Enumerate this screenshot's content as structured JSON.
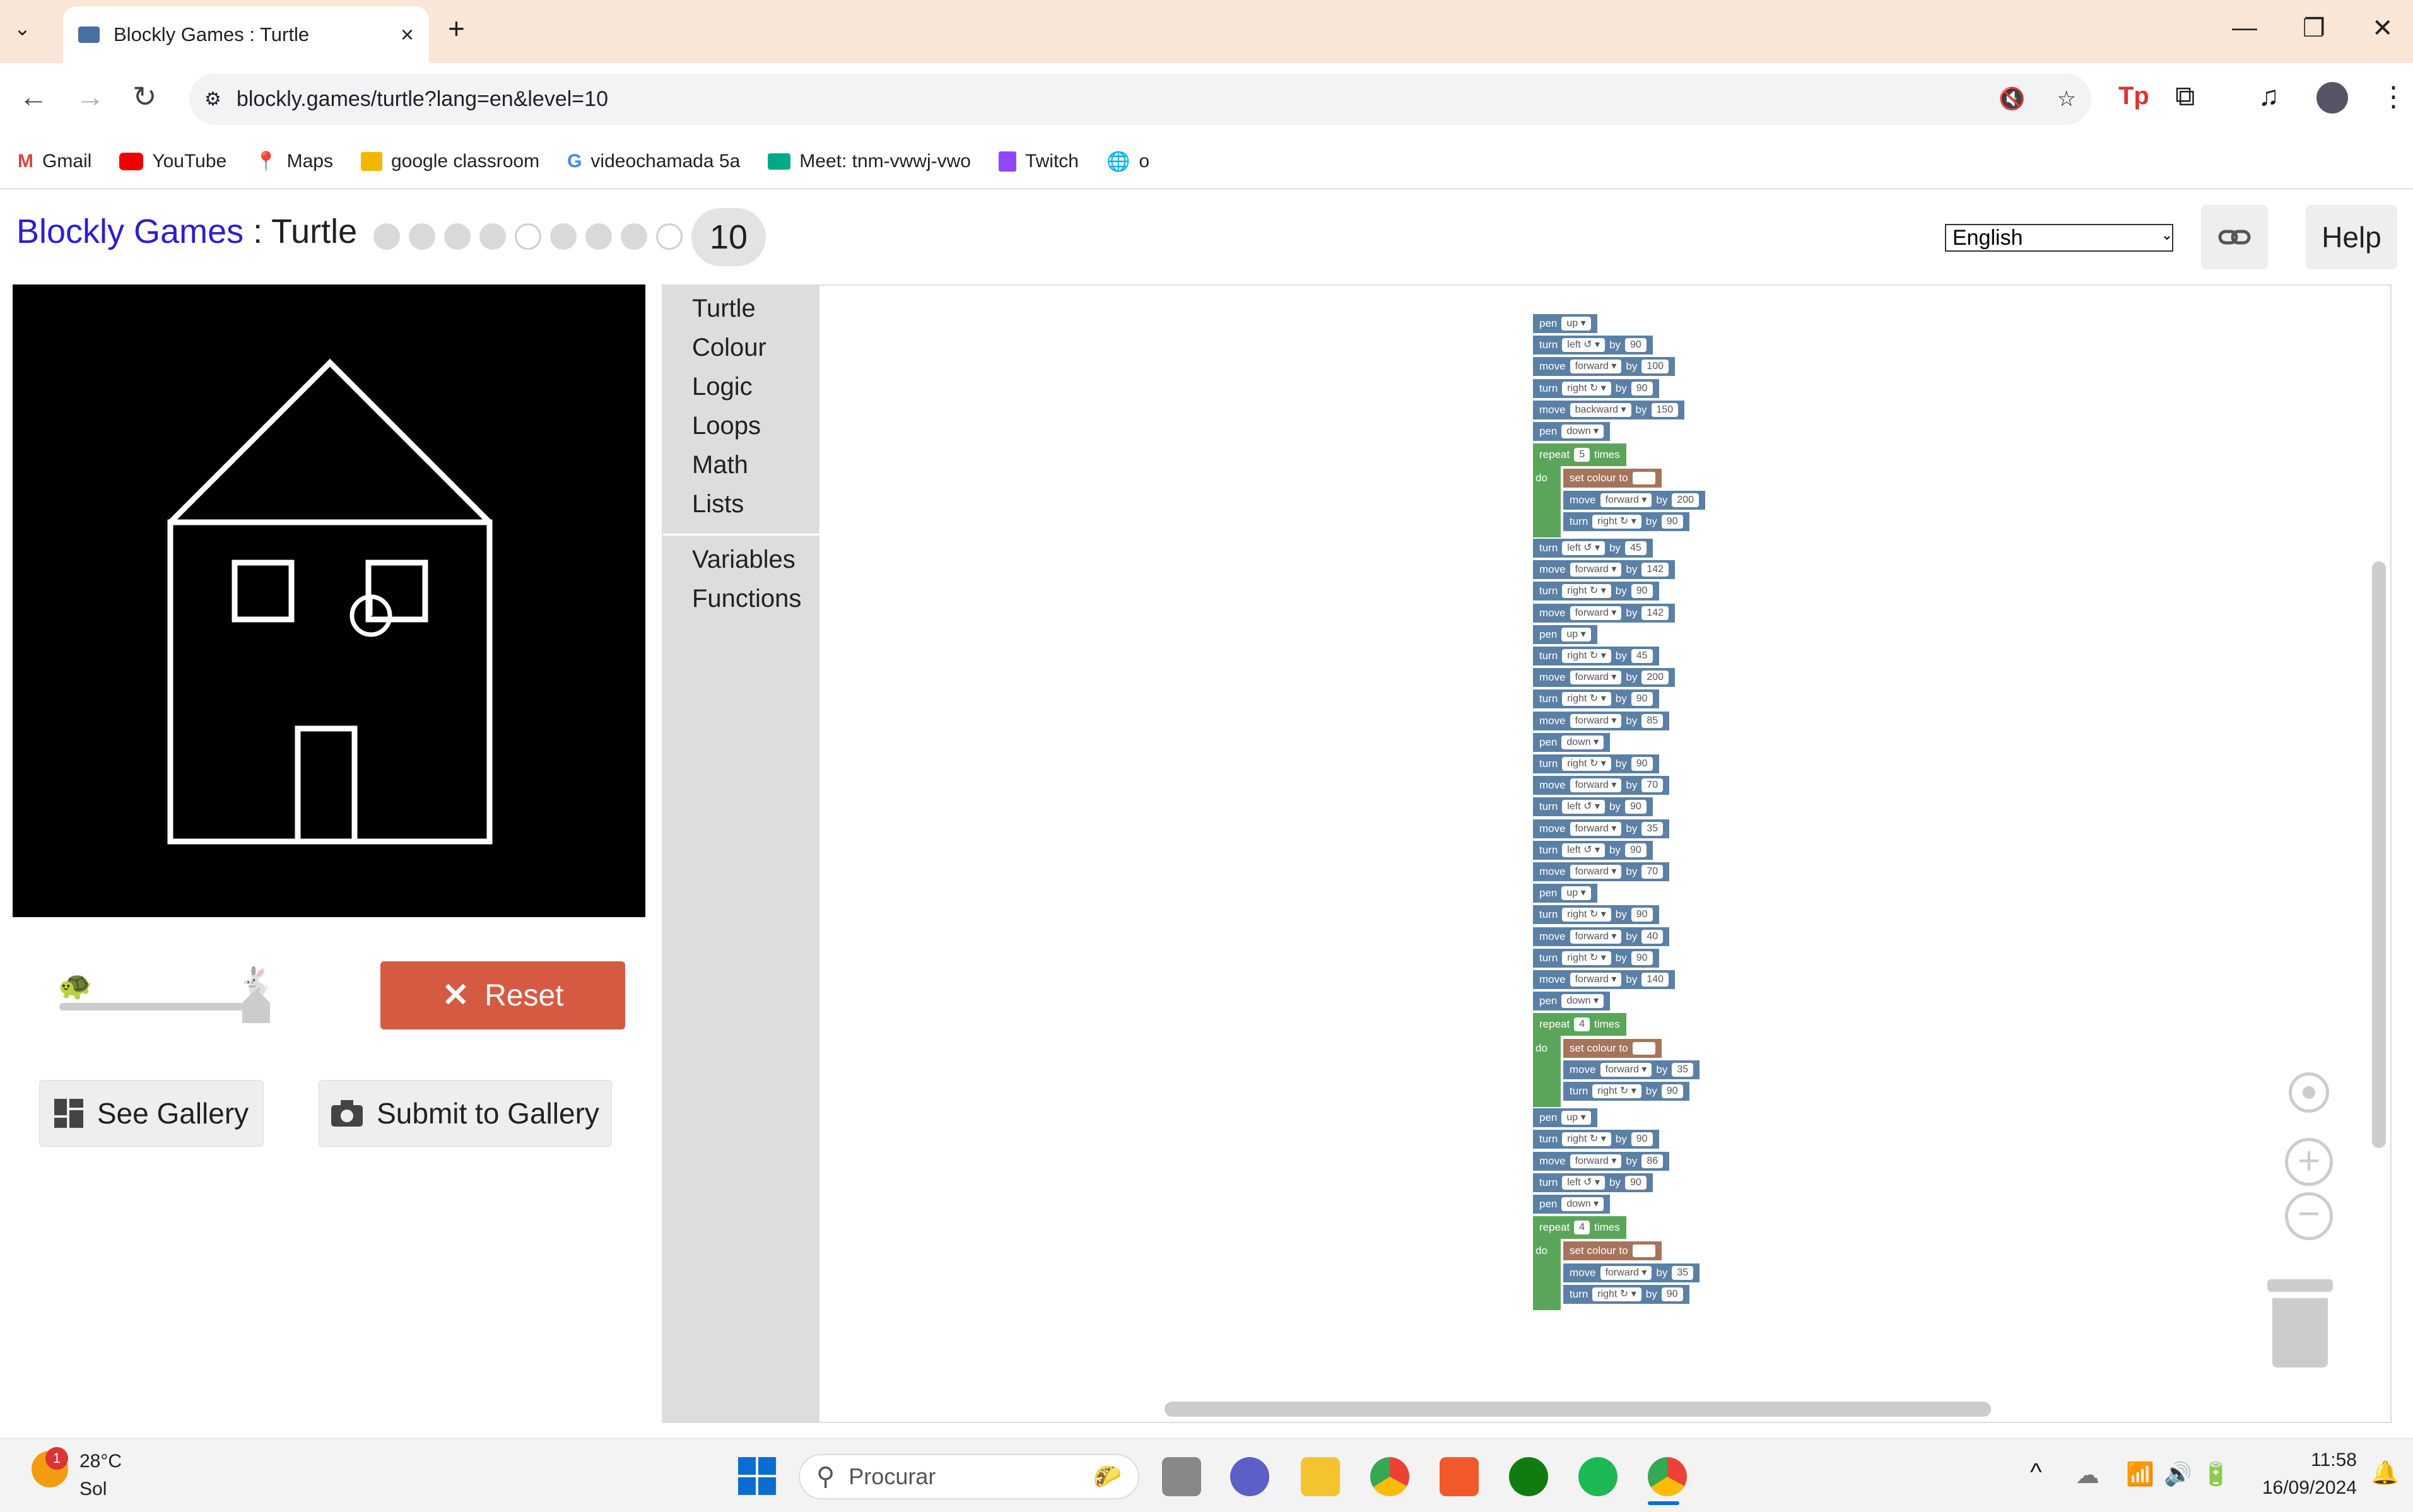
{
  "browser": {
    "tab_title": "Blockly Games : Turtle",
    "url": "blockly.games/turtle?lang=en&level=10",
    "bookmarks": [
      "Gmail",
      "YouTube",
      "Maps",
      "google classroom",
      "videochamada 5a",
      "Meet: tnm-vwwj-vwo",
      "Twitch",
      "o"
    ]
  },
  "header": {
    "brand": "Blockly Games",
    "separator": " : ",
    "game": "Turtle",
    "level": "10",
    "language": "English",
    "help_label": "Help"
  },
  "controls": {
    "reset_label": "Reset",
    "see_gallery_label": "See Gallery",
    "submit_gallery_label": "Submit to Gallery"
  },
  "toolbox": {
    "categories": [
      "Turtle",
      "Colour",
      "Logic",
      "Loops",
      "Math",
      "Lists"
    ],
    "categories2": [
      "Variables",
      "Functions"
    ]
  },
  "program": [
    {
      "t": "pen",
      "a": "up"
    },
    {
      "t": "turn",
      "a": "left ↺",
      "v": "90"
    },
    {
      "t": "move",
      "a": "forward",
      "v": "100"
    },
    {
      "t": "turn",
      "a": "right ↻",
      "v": "90"
    },
    {
      "t": "move",
      "a": "backward",
      "v": "150"
    },
    {
      "t": "pen",
      "a": "down"
    },
    {
      "t": "repeat",
      "v": "5"
    },
    {
      "t": "colour",
      "indent": 1
    },
    {
      "t": "move",
      "a": "forward",
      "v": "200",
      "indent": 1
    },
    {
      "t": "turn",
      "a": "right ↻",
      "v": "90",
      "indent": 1
    },
    {
      "t": "turn",
      "a": "left ↺",
      "v": "45"
    },
    {
      "t": "move",
      "a": "forward",
      "v": "142"
    },
    {
      "t": "turn",
      "a": "right ↻",
      "v": "90"
    },
    {
      "t": "move",
      "a": "forward",
      "v": "142"
    },
    {
      "t": "pen",
      "a": "up"
    },
    {
      "t": "turn",
      "a": "right ↻",
      "v": "45"
    },
    {
      "t": "move",
      "a": "forward",
      "v": "200"
    },
    {
      "t": "turn",
      "a": "right ↻",
      "v": "90"
    },
    {
      "t": "move",
      "a": "forward",
      "v": "85"
    },
    {
      "t": "pen",
      "a": "down"
    },
    {
      "t": "turn",
      "a": "right ↻",
      "v": "90"
    },
    {
      "t": "move",
      "a": "forward",
      "v": "70"
    },
    {
      "t": "turn",
      "a": "left ↺",
      "v": "90"
    },
    {
      "t": "move",
      "a": "forward",
      "v": "35"
    },
    {
      "t": "turn",
      "a": "left ↺",
      "v": "90"
    },
    {
      "t": "move",
      "a": "forward",
      "v": "70"
    },
    {
      "t": "pen",
      "a": "up"
    },
    {
      "t": "turn",
      "a": "right ↻",
      "v": "90"
    },
    {
      "t": "move",
      "a": "forward",
      "v": "40"
    },
    {
      "t": "turn",
      "a": "right ↻",
      "v": "90"
    },
    {
      "t": "move",
      "a": "forward",
      "v": "140"
    },
    {
      "t": "pen",
      "a": "down"
    },
    {
      "t": "repeat",
      "v": "4"
    },
    {
      "t": "colour",
      "indent": 1
    },
    {
      "t": "move",
      "a": "forward",
      "v": "35",
      "indent": 1
    },
    {
      "t": "turn",
      "a": "right ↻",
      "v": "90",
      "indent": 1
    },
    {
      "t": "pen",
      "a": "up"
    },
    {
      "t": "turn",
      "a": "right ↻",
      "v": "90"
    },
    {
      "t": "move",
      "a": "forward",
      "v": "86"
    },
    {
      "t": "turn",
      "a": "left ↺",
      "v": "90"
    },
    {
      "t": "pen",
      "a": "down"
    },
    {
      "t": "repeat",
      "v": "4"
    },
    {
      "t": "colour",
      "indent": 1
    },
    {
      "t": "move",
      "a": "forward",
      "v": "35",
      "indent": 1
    },
    {
      "t": "turn",
      "a": "right ↻",
      "v": "90",
      "indent": 1
    }
  ],
  "block_words": {
    "by": "by",
    "times": "times",
    "do": "do",
    "repeat": "repeat",
    "set_colour": "set colour to"
  },
  "taskbar": {
    "weather_temp": "28°C",
    "weather_desc": "Sol",
    "weather_badge": "1",
    "search_placeholder": "Procurar",
    "time": "11:58",
    "date": "16/09/2024"
  },
  "colors": {
    "turtle_block": "#5b80a5",
    "pen_block": "#5b80a5",
    "loop_block": "#5ba55b",
    "colour_block": "#a5745b",
    "brand": "#2a1fd1",
    "reset": "#d65a41"
  }
}
